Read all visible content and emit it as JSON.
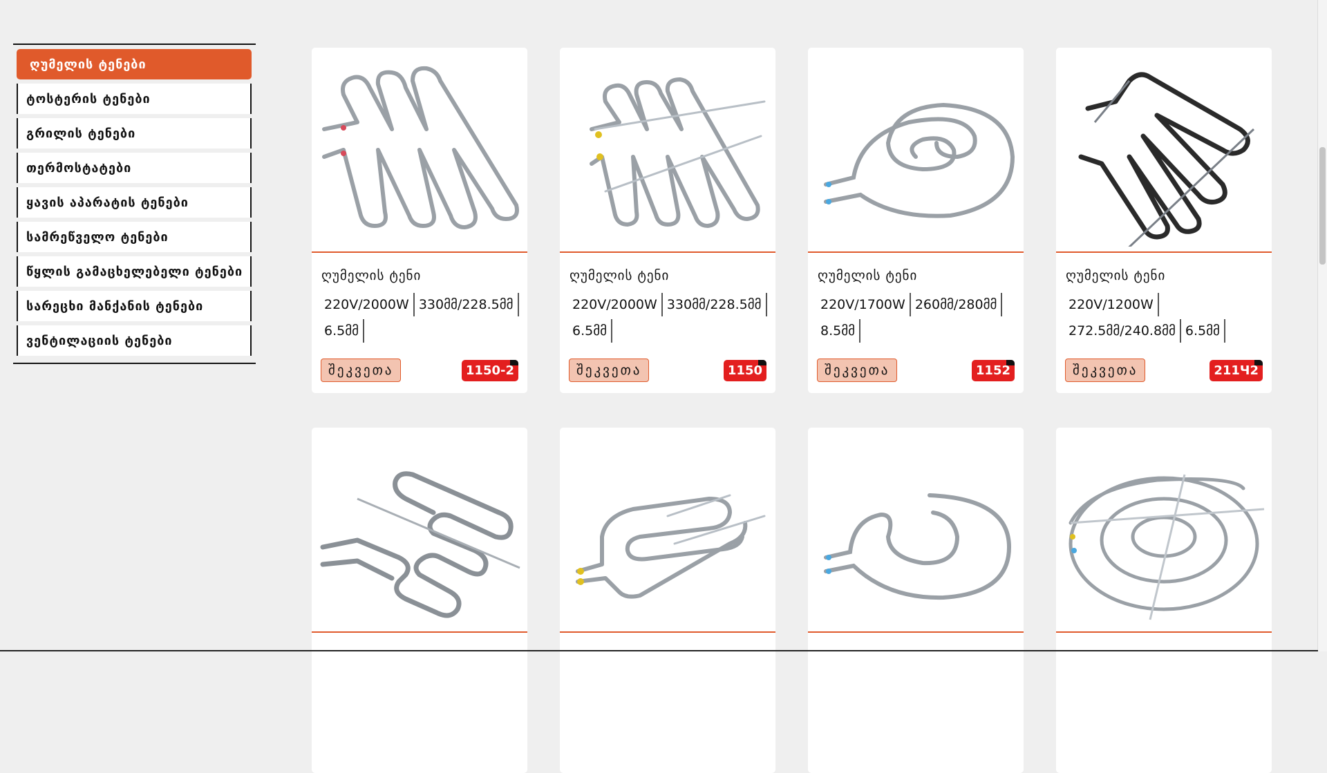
{
  "sidebar": {
    "items": [
      {
        "label": "ღუმელის ტენები",
        "active": true
      },
      {
        "label": "ტოსტერის ტენები"
      },
      {
        "label": "გრილის ტენები"
      },
      {
        "label": "თერმოსტატები"
      },
      {
        "label": "ყავის აპარატის ტენები"
      },
      {
        "label": "სამრეწველო ტენები"
      },
      {
        "label": "წყლის გამაცხელებელი ტენები"
      },
      {
        "label": "სარეცხი მანქანის ტენები"
      },
      {
        "label": "ვენტილაციის ტენები"
      }
    ]
  },
  "products": [
    {
      "title": "ღუმელის ტენი",
      "specs": [
        "220V/2000W",
        "330მმ/228.5მმ",
        "6.5მმ"
      ],
      "order_label": "შეკვეთა",
      "code": "1150-2",
      "icon": "zigzag-heating-element-icon"
    },
    {
      "title": "ღუმელის ტენი",
      "specs": [
        "220V/2000W",
        "330მმ/228.5მმ",
        "6.5მმ"
      ],
      "order_label": "შეკვეთა",
      "code": "1150",
      "icon": "zigzag-heating-element-icon"
    },
    {
      "title": "ღუმელის ტენი",
      "specs": [
        "220V/1700W",
        "260მმ/280მმ",
        "8.5მმ"
      ],
      "order_label": "შეკვეთა",
      "code": "1152",
      "icon": "spiral-heating-element-icon"
    },
    {
      "title": "ღუმელის ტენი",
      "specs": [
        "220V/1200W",
        "272.5მმ/240.8მმ",
        "6.5მმ"
      ],
      "order_label": "შეკვეთა",
      "code": "211Ч2",
      "icon": "dark-zigzag-heating-element-icon"
    },
    {
      "icon": "zigzag-heating-element-icon"
    },
    {
      "icon": "loop-heating-element-icon"
    },
    {
      "icon": "spiral-heating-element-icon"
    },
    {
      "icon": "round-spiral-heating-element-icon"
    }
  ],
  "colors": {
    "accent": "#e05a2b",
    "badge": "#e31f1f",
    "order_bg": "#f3c4b1",
    "background": "#efefef"
  }
}
